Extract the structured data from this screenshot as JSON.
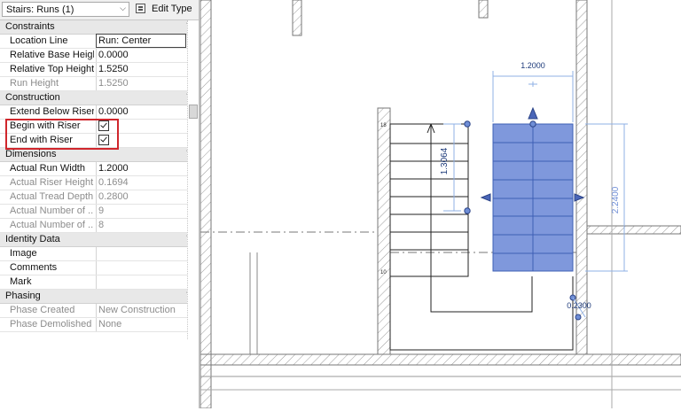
{
  "type_selector": {
    "value": "Stairs: Runs (1)",
    "edit_type_label": "Edit Type"
  },
  "properties": {
    "constraints": {
      "header": "Constraints",
      "location_line": {
        "label": "Location Line",
        "value": "Run: Center"
      },
      "relative_base_height": {
        "label": "Relative Base Height",
        "value": "0.0000"
      },
      "relative_top_height": {
        "label": "Relative Top Height",
        "value": "1.5250"
      },
      "run_height": {
        "label": "Run Height",
        "value": "1.5250"
      }
    },
    "construction": {
      "header": "Construction",
      "extend_below": {
        "label": "Extend Below Riser...",
        "value": "0.0000"
      },
      "begin_with_riser": {
        "label": "Begin with Riser",
        "checked": true
      },
      "end_with_riser": {
        "label": "End with Riser",
        "checked": true
      }
    },
    "dimensions": {
      "header": "Dimensions",
      "actual_run_width": {
        "label": "Actual Run Width",
        "value": "1.2000"
      },
      "actual_riser_height": {
        "label": "Actual Riser Height",
        "value": "0.1694"
      },
      "actual_tread_depth": {
        "label": "Actual Tread Depth",
        "value": "0.2800"
      },
      "actual_number_1": {
        "label": "Actual Number of ...",
        "value": "9"
      },
      "actual_number_2": {
        "label": "Actual Number of ...",
        "value": "8"
      }
    },
    "identity": {
      "header": "Identity Data",
      "image": {
        "label": "Image"
      },
      "comments": {
        "label": "Comments"
      },
      "mark": {
        "label": "Mark"
      }
    },
    "phasing": {
      "header": "Phasing",
      "phase_created": {
        "label": "Phase Created",
        "value": "New Construction"
      },
      "phase_demolished": {
        "label": "Phase Demolished",
        "value": "None"
      }
    }
  },
  "drawing": {
    "dim_top": "1.2000",
    "dim_left": "1.3064",
    "dim_right": "2.2400",
    "dim_bottom": "0.2300",
    "tread_label_top": "18",
    "tread_label_bottom": "10",
    "selection_color": "#7f98dc",
    "dim_color": "#8fb0e6"
  }
}
